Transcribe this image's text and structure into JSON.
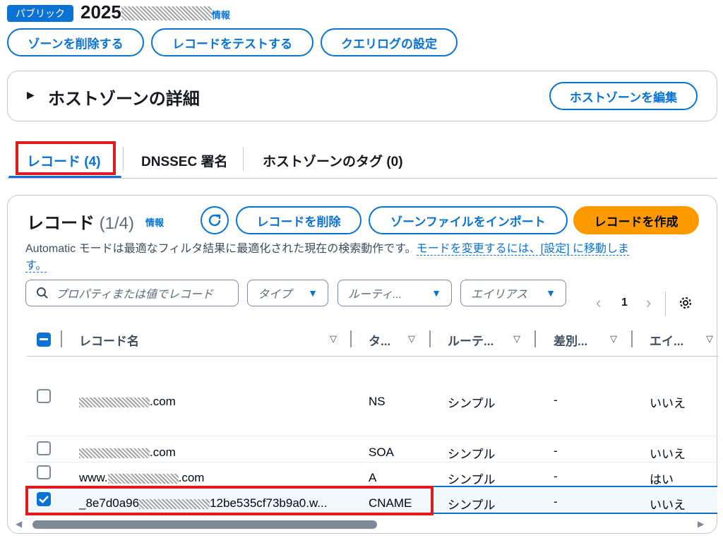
{
  "header": {
    "badge": "パブリック",
    "title_prefix": "2025",
    "info": "情報"
  },
  "actions": {
    "delete_zone": "ゾーンを削除する",
    "test_record": "レコードをテストする",
    "query_log": "クエリログの設定"
  },
  "details": {
    "title": "ホストゾーンの詳細",
    "edit_button": "ホストゾーンを編集"
  },
  "tabs": [
    {
      "label": "レコード (4)"
    },
    {
      "label": "DNSSEC 署名"
    },
    {
      "label": "ホストゾーンのタグ (0)"
    }
  ],
  "records_panel": {
    "title": "レコード",
    "count": "(1/4)",
    "info": "情報",
    "delete_button": "レコードを削除",
    "import_button": "ゾーンファイルをインポート",
    "create_button": "レコードを作成",
    "description": "Automatic モードは最適なフィルタ結果に最適化された現在の検索動作です。",
    "mode_link_1": "モードを変更するには、[設定] に移動しま",
    "mode_link_2": "す。",
    "search_placeholder": "プロパティまたは値でレコード",
    "filters": [
      "タイプ",
      "ルーティ...",
      "エイリアス"
    ],
    "page": "1"
  },
  "table": {
    "columns": [
      "レコード名",
      "タ...",
      "ルーテ...",
      "差別...",
      "エイ..."
    ],
    "rows": [
      {
        "name_prefix": "",
        "name_suffix": ".com",
        "type": "NS",
        "routing": "シンプル",
        "diff": "-",
        "alias": "いいえ",
        "checked": false
      },
      {
        "name_prefix": "",
        "name_suffix": ".com",
        "type": "SOA",
        "routing": "シンプル",
        "diff": "-",
        "alias": "いいえ",
        "checked": false
      },
      {
        "name_prefix": "www.",
        "name_suffix": ".com",
        "type": "A",
        "routing": "シンプル",
        "diff": "-",
        "alias": "はい",
        "checked": false
      },
      {
        "name_prefix": "_8e7d0a96",
        "name_suffix": "12be535cf73b9a0.w...",
        "type": "CNAME",
        "routing": "シンプル",
        "diff": "-",
        "alias": "いいえ",
        "checked": true
      }
    ]
  },
  "colors": {
    "accent": "#0972d3",
    "primary_button": "#ff9900",
    "highlight": "#e01b1b"
  }
}
